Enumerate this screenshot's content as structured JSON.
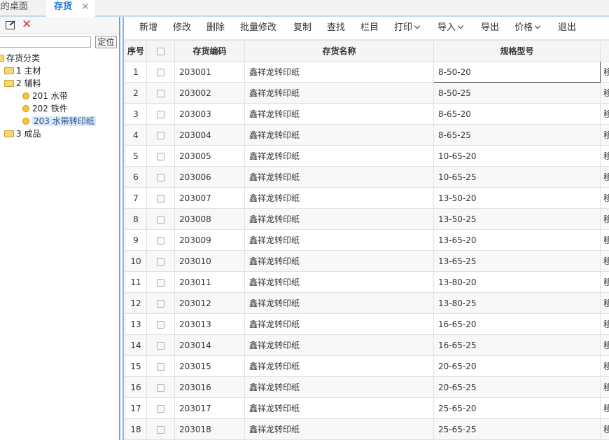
{
  "tabs": [
    {
      "label": "我的桌面"
    },
    {
      "label": "存货",
      "close": "✕"
    }
  ],
  "left_panel": {
    "locate_button": "定位",
    "tree": [
      {
        "label": "存货分类",
        "type": "folder"
      },
      {
        "label": "1 主材",
        "type": "folder"
      },
      {
        "label": "2 辅料",
        "type": "folder"
      },
      {
        "label": "201 水带",
        "type": "leaf"
      },
      {
        "label": "202 铁件",
        "type": "leaf"
      },
      {
        "label": "203 水带转印纸",
        "type": "leaf",
        "selected": true
      },
      {
        "label": "3 成品",
        "type": "folder"
      }
    ]
  },
  "toolbar": {
    "new": "新增",
    "edit": "修改",
    "delete": "删除",
    "batch_edit": "批量修改",
    "copy": "复制",
    "find": "查找",
    "columns": "栏目",
    "print": "打印",
    "import": "导入",
    "export": "导出",
    "price": "价格",
    "exit": "退出"
  },
  "table": {
    "headers": {
      "seq": "序号",
      "code": "存货编码",
      "name": "存货名称",
      "spec": "规格型号"
    },
    "rows": [
      {
        "seq": "1",
        "code": "203001",
        "name": "鑫祥龙转印纸",
        "spec": "8-50-20",
        "extra": "移"
      },
      {
        "seq": "2",
        "code": "203002",
        "name": "鑫祥龙转印纸",
        "spec": "8-50-25",
        "extra": "移"
      },
      {
        "seq": "3",
        "code": "203003",
        "name": "鑫祥龙转印纸",
        "spec": "8-65-20",
        "extra": "移"
      },
      {
        "seq": "4",
        "code": "203004",
        "name": "鑫祥龙转印纸",
        "spec": "8-65-25",
        "extra": "移"
      },
      {
        "seq": "5",
        "code": "203005",
        "name": "鑫祥龙转印纸",
        "spec": "10-65-20",
        "extra": "移"
      },
      {
        "seq": "6",
        "code": "203006",
        "name": "鑫祥龙转印纸",
        "spec": "10-65-25",
        "extra": "移"
      },
      {
        "seq": "7",
        "code": "203007",
        "name": "鑫祥龙转印纸",
        "spec": "13-50-20",
        "extra": "移"
      },
      {
        "seq": "8",
        "code": "203008",
        "name": "鑫祥龙转印纸",
        "spec": "13-50-25",
        "extra": "移"
      },
      {
        "seq": "9",
        "code": "203009",
        "name": "鑫祥龙转印纸",
        "spec": "13-65-20",
        "extra": "移"
      },
      {
        "seq": "10",
        "code": "203010",
        "name": "鑫祥龙转印纸",
        "spec": "13-65-25",
        "extra": "移"
      },
      {
        "seq": "11",
        "code": "203011",
        "name": "鑫祥龙转印纸",
        "spec": "13-80-20",
        "extra": "移"
      },
      {
        "seq": "12",
        "code": "203012",
        "name": "鑫祥龙转印纸",
        "spec": "13-80-25",
        "extra": "移"
      },
      {
        "seq": "13",
        "code": "203013",
        "name": "鑫祥龙转印纸",
        "spec": "16-65-20",
        "extra": "移"
      },
      {
        "seq": "14",
        "code": "203014",
        "name": "鑫祥龙转印纸",
        "spec": "16-65-25",
        "extra": "移"
      },
      {
        "seq": "15",
        "code": "203015",
        "name": "鑫祥龙转印纸",
        "spec": "20-65-20",
        "extra": "移"
      },
      {
        "seq": "16",
        "code": "203016",
        "name": "鑫祥龙转印纸",
        "spec": "20-65-25",
        "extra": "移"
      },
      {
        "seq": "17",
        "code": "203017",
        "name": "鑫祥龙转印纸",
        "spec": "25-65-20",
        "extra": "移"
      },
      {
        "seq": "18",
        "code": "203018",
        "name": "鑫祥龙转印纸",
        "spec": "25-65-25",
        "extra": "移"
      }
    ]
  },
  "colors": {
    "accent": "#1f7ad8",
    "delete_icon": "#e0352b",
    "folder": "#f8d775",
    "leaf": "#f6c531"
  }
}
